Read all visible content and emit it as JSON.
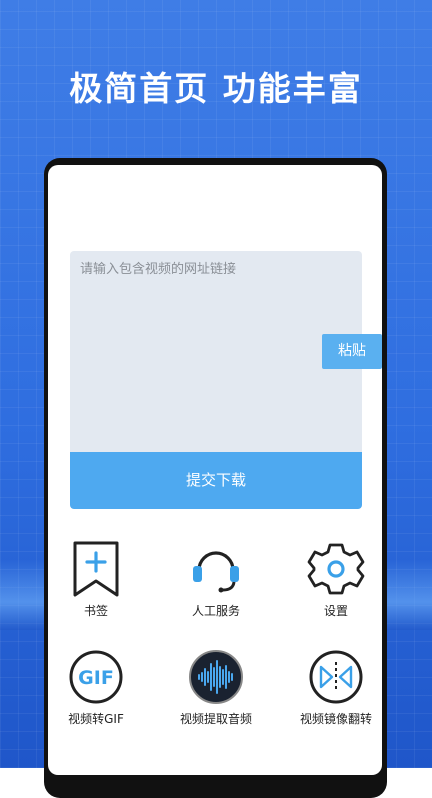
{
  "headline": "极简首页 功能丰富",
  "url_input": {
    "placeholder": "请输入包含视频的网址链接",
    "value": ""
  },
  "paste_label": "粘贴",
  "submit_label": "提交下载",
  "tools": [
    {
      "label": "书签",
      "icon": "bookmark-plus-icon"
    },
    {
      "label": "人工服务",
      "icon": "headset-icon"
    },
    {
      "label": "设置",
      "icon": "gear-icon"
    },
    {
      "label": "视频转GIF",
      "icon": "gif-icon",
      "icon_text": "GIF"
    },
    {
      "label": "视频提取音频",
      "icon": "audio-waveform-icon"
    },
    {
      "label": "视频镜像翻转",
      "icon": "mirror-flip-icon"
    }
  ],
  "colors": {
    "background": "#3f7de6",
    "accent": "#4ea9f0",
    "input_bg": "#e3e9f1",
    "icon_blue": "#3aa0e8"
  }
}
